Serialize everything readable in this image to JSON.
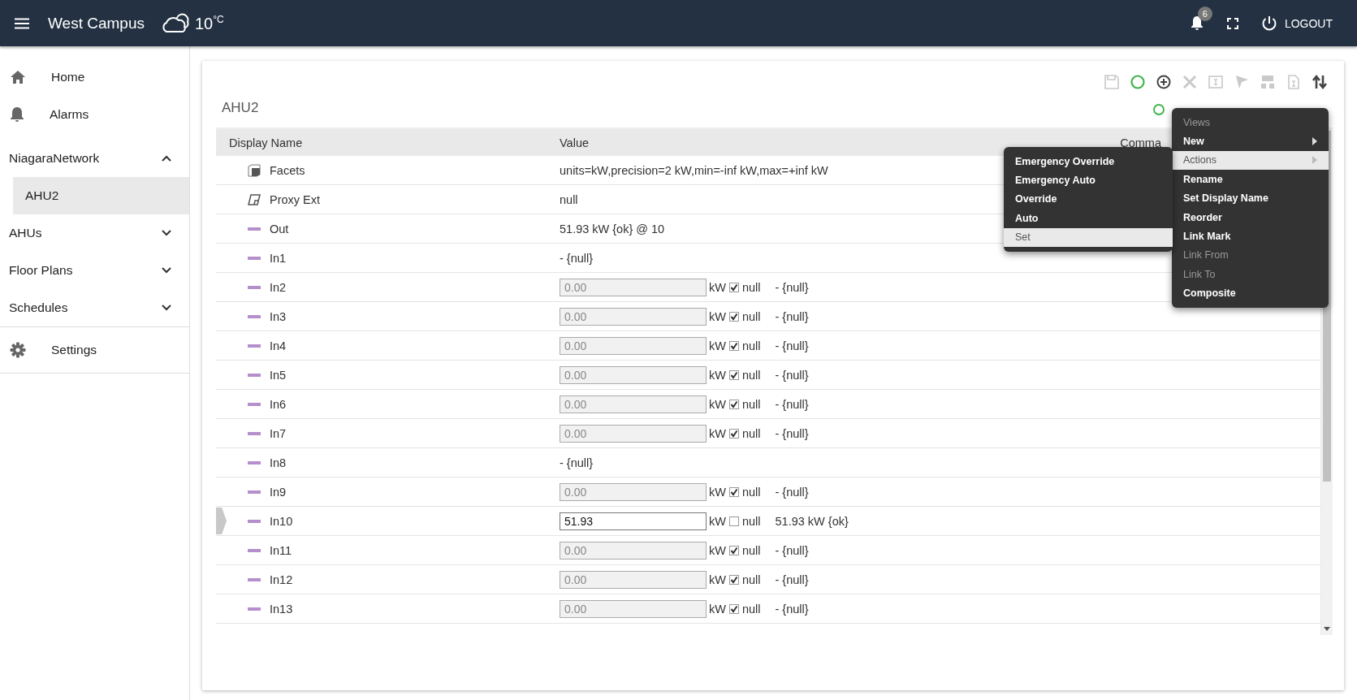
{
  "header": {
    "site": "West Campus",
    "temperature": "10$^{°C}$",
    "notification_count": "6",
    "logout": "LOGOUT"
  },
  "sidebar": {
    "items": [
      {
        "label": "Home",
        "kind": "home",
        "selected": false
      },
      {
        "label": "Alarms",
        "kind": "alarm",
        "selected": false
      },
      {
        "label": "NiagaraNetwork",
        "kind": "group",
        "expanded": true,
        "children": [
          {
            "label": "AHU2",
            "selected": true
          }
        ]
      },
      {
        "label": "AHUs",
        "kind": "group",
        "expanded": false
      },
      {
        "label": "Floor Plans",
        "kind": "group",
        "expanded": false
      },
      {
        "label": "Schedules",
        "kind": "group",
        "expanded": false
      },
      {
        "label": "Settings",
        "kind": "settings",
        "selected": false
      }
    ]
  },
  "toolbar": [
    {
      "kind": "save",
      "disabled": true
    },
    {
      "kind": "status",
      "disabled": false
    },
    {
      "kind": "add",
      "disabled": false
    },
    {
      "kind": "delete",
      "disabled": true
    },
    {
      "kind": "rename",
      "disabled": true
    },
    {
      "kind": "flag",
      "disabled": true
    },
    {
      "kind": "hierarchy",
      "disabled": true
    },
    {
      "kind": "document",
      "disabled": true
    },
    {
      "kind": "sort",
      "disabled": false
    }
  ],
  "title": "AHU2",
  "table": {
    "columns": [
      "Display Name",
      "Value",
      "Comma"
    ],
    "rows": [
      {
        "name": "Facets",
        "kind": "facets",
        "value": "units=kW,precision=2 kW,min=-inf kW,max=+inf kW",
        "selected": false
      },
      {
        "name": "Proxy Ext",
        "kind": "proxy",
        "value": "null",
        "selected": false
      },
      {
        "name": "Out",
        "kind": "text",
        "value": "51.93 kW {ok} @ 10",
        "selected": false
      },
      {
        "name": "In1",
        "kind": "text",
        "value": "- {null}",
        "selected": false
      },
      {
        "name": "In2",
        "kind": "input",
        "value": "0.00",
        "unit": "kW",
        "null_checked": true,
        "null_label": "null",
        "status": "- {null}",
        "selected": false
      },
      {
        "name": "In3",
        "kind": "input",
        "value": "0.00",
        "unit": "kW",
        "null_checked": true,
        "null_label": "null",
        "status": "- {null}",
        "selected": false
      },
      {
        "name": "In4",
        "kind": "input",
        "value": "0.00",
        "unit": "kW",
        "null_checked": true,
        "null_label": "null",
        "status": "- {null}",
        "selected": false
      },
      {
        "name": "In5",
        "kind": "input",
        "value": "0.00",
        "unit": "kW",
        "null_checked": true,
        "null_label": "null",
        "status": "- {null}",
        "selected": false
      },
      {
        "name": "In6",
        "kind": "input",
        "value": "0.00",
        "unit": "kW",
        "null_checked": true,
        "null_label": "null",
        "status": "- {null}",
        "selected": false
      },
      {
        "name": "In7",
        "kind": "input",
        "value": "0.00",
        "unit": "kW",
        "null_checked": true,
        "null_label": "null",
        "status": "- {null}",
        "selected": false
      },
      {
        "name": "In8",
        "kind": "text",
        "value": "- {null}",
        "selected": false
      },
      {
        "name": "In9",
        "kind": "input",
        "value": "0.00",
        "unit": "kW",
        "null_checked": true,
        "null_label": "null",
        "status": "- {null}",
        "selected": false
      },
      {
        "name": "In10",
        "kind": "input",
        "value": "51.93",
        "unit": "kW",
        "null_checked": false,
        "null_label": "null",
        "status": "51.93 kW {ok}",
        "selected": true
      },
      {
        "name": "In11",
        "kind": "input",
        "value": "0.00",
        "unit": "kW",
        "null_checked": true,
        "null_label": "null",
        "status": "- {null}",
        "selected": false
      },
      {
        "name": "In12",
        "kind": "input",
        "value": "0.00",
        "unit": "kW",
        "null_checked": true,
        "null_label": "null",
        "status": "- {null}",
        "selected": false
      },
      {
        "name": "In13",
        "kind": "input",
        "value": "0.00",
        "unit": "kW",
        "null_checked": true,
        "null_label": "null",
        "status": "- {null}",
        "selected": false
      }
    ]
  },
  "context_menu": {
    "items": [
      {
        "label": "Views",
        "disabled": true,
        "selected": false,
        "submenu": false
      },
      {
        "label": "New",
        "disabled": false,
        "selected": false,
        "submenu": true
      },
      {
        "label": "Actions",
        "disabled": false,
        "selected": true,
        "submenu": true
      },
      {
        "label": "Rename",
        "disabled": false,
        "selected": false,
        "submenu": false
      },
      {
        "label": "Set Display Name",
        "disabled": false,
        "selected": false,
        "submenu": false
      },
      {
        "label": "Reorder",
        "disabled": false,
        "selected": false,
        "submenu": false
      },
      {
        "label": "Link Mark",
        "disabled": false,
        "selected": false,
        "submenu": false
      },
      {
        "label": "Link From",
        "disabled": true,
        "selected": false,
        "submenu": false
      },
      {
        "label": "Link To",
        "disabled": true,
        "selected": false,
        "submenu": false
      },
      {
        "label": "Composite",
        "disabled": false,
        "selected": false,
        "submenu": false
      }
    ]
  },
  "actions_submenu": {
    "items": [
      {
        "label": "Emergency Override",
        "selected": false
      },
      {
        "label": "Emergency Auto",
        "selected": false
      },
      {
        "label": "Override",
        "selected": false
      },
      {
        "label": "Auto",
        "selected": false
      },
      {
        "label": "Set",
        "selected": true
      }
    ]
  }
}
